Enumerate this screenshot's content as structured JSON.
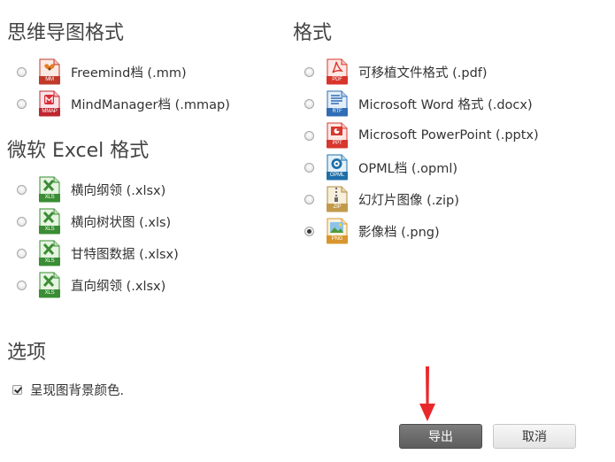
{
  "sections": {
    "mindmap_heading": "思维导图格式",
    "excel_heading": "微软 Excel 格式",
    "format_heading": "格式",
    "options_heading": "选项"
  },
  "mindmap_options": [
    {
      "label": "Freemind档 (.mm)",
      "tag": "MM",
      "icon": "freemind-file-icon",
      "checked": false
    },
    {
      "label": "MindManager档 (.mmap)",
      "tag": "MMAP",
      "icon": "mindmanager-file-icon",
      "checked": false
    }
  ],
  "excel_options": [
    {
      "label": "横向纲领 (.xlsx)",
      "tag": "XLS",
      "icon": "excel-file-icon",
      "checked": false
    },
    {
      "label": "横向树状图 (.xls)",
      "tag": "XLS",
      "icon": "excel-file-icon",
      "checked": false
    },
    {
      "label": "甘特图数据 (.xlsx)",
      "tag": "XLS",
      "icon": "excel-file-icon",
      "checked": false
    },
    {
      "label": "直向纲领 (.xlsx)",
      "tag": "XLS",
      "icon": "excel-file-icon",
      "checked": false
    }
  ],
  "format_options": [
    {
      "label": "可移植文件格式 (.pdf)",
      "tag": "PDF",
      "icon": "pdf-file-icon",
      "checked": false
    },
    {
      "label": "Microsoft Word 格式 (.docx)",
      "tag": "RTF",
      "icon": "word-file-icon",
      "checked": false
    },
    {
      "label": "Microsoft PowerPoint (.pptx)",
      "tag": "PPT",
      "icon": "powerpoint-file-icon",
      "checked": false
    },
    {
      "label": "OPML档 (.opml)",
      "tag": "OPML",
      "icon": "opml-file-icon",
      "checked": false
    },
    {
      "label": "幻灯片图像 (.zip)",
      "tag": "ZIP",
      "icon": "zip-file-icon",
      "checked": false
    },
    {
      "label": "影像档 (.png)",
      "tag": "PNG",
      "icon": "image-file-icon",
      "checked": true
    }
  ],
  "options": {
    "show_background_label": "呈现图背景颜色.",
    "show_background_checked": true
  },
  "buttons": {
    "export_label": "导出",
    "cancel_label": "取消"
  },
  "colors": {
    "annotation_arrow": "#e8282b",
    "export_button": "#6b6b6b"
  }
}
